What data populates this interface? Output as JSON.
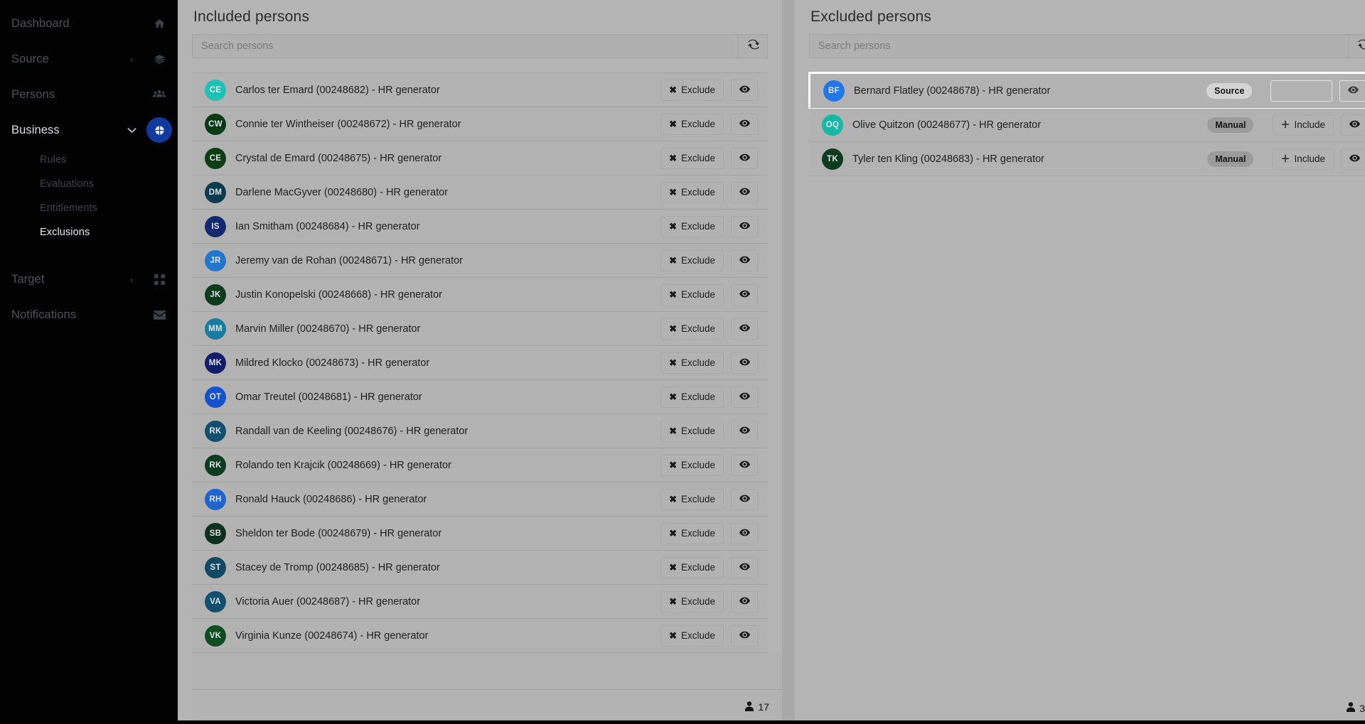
{
  "sidebar": {
    "items": [
      {
        "label": "Dashboard",
        "icon": "home-icon",
        "state": "dim",
        "caret": ""
      },
      {
        "label": "Source",
        "icon": "layers-icon",
        "state": "dim",
        "caret": "‹"
      },
      {
        "label": "Persons",
        "icon": "people-icon",
        "state": "dim",
        "caret": ""
      },
      {
        "label": "Business",
        "icon": "pie-chart-icon",
        "state": "active",
        "caret": "⌄"
      }
    ],
    "submenu": [
      {
        "label": "Rules",
        "active": false
      },
      {
        "label": "Evaluations",
        "active": false
      },
      {
        "label": "Entitlements",
        "active": false
      },
      {
        "label": "Exclusions",
        "active": true
      }
    ],
    "items_bottom": [
      {
        "label": "Target",
        "icon": "grid-icon",
        "state": "dim",
        "caret": "‹"
      },
      {
        "label": "Notifications",
        "icon": "envelope-icon",
        "state": "dim",
        "caret": ""
      }
    ],
    "accent_color": "#11399e"
  },
  "included": {
    "title": "Included persons",
    "search_placeholder": "Search persons",
    "search_value": "",
    "refresh_icon": "refresh-icon",
    "count": "17",
    "count_icon": "person-icon",
    "action_label": "Exclude",
    "action_glyph": "✖",
    "view_icon": "eye-icon",
    "persons": [
      {
        "initials": "CE",
        "color": "#1fc1b6",
        "label": "Carlos ter Emard (00248682) - HR generator"
      },
      {
        "initials": "CW",
        "color": "#073b15",
        "label": "Connie ter Wintheiser (00248672) - HR generator"
      },
      {
        "initials": "CE",
        "color": "#0c3d13",
        "label": "Crystal de Emard (00248675) - HR generator"
      },
      {
        "initials": "DM",
        "color": "#0c3a4f",
        "label": "Darlene MacGyver (00248680) - HR generator"
      },
      {
        "initials": "IS",
        "color": "#132a6e",
        "label": "Ian Smitham (00248684) - HR generator"
      },
      {
        "initials": "JR",
        "color": "#2277cd",
        "label": "Jeremy van de Rohan (00248671) - HR generator"
      },
      {
        "initials": "JK",
        "color": "#0d3b1e",
        "label": "Justin Konopelski (00248668) - HR generator"
      },
      {
        "initials": "MM",
        "color": "#187ca2",
        "label": "Marvin Miller (00248670) - HR generator"
      },
      {
        "initials": "MK",
        "color": "#131e6b",
        "label": "Mildred Klocko (00248673) - HR generator"
      },
      {
        "initials": "OT",
        "color": "#1451cf",
        "label": "Omar Treutel (00248681) - HR generator"
      },
      {
        "initials": "RK",
        "color": "#12506e",
        "label": "Randall van de Keeling (00248676) - HR generator"
      },
      {
        "initials": "RK",
        "color": "#0b3b20",
        "label": "Rolando ten Krajcik (00248669) - HR generator"
      },
      {
        "initials": "RH",
        "color": "#1f63cc",
        "label": "Ronald Hauck (00248686) - HR generator"
      },
      {
        "initials": "SB",
        "color": "#0c3022",
        "label": "Sheldon ter Bode (00248679) - HR generator"
      },
      {
        "initials": "ST",
        "color": "#114a62",
        "label": "Stacey de Tromp (00248685) - HR generator"
      },
      {
        "initials": "VA",
        "color": "#14506d",
        "label": "Victoria Auer (00248687) - HR generator"
      },
      {
        "initials": "VK",
        "color": "#0d4d21",
        "label": "Virginia Kunze (00248674) - HR generator"
      }
    ]
  },
  "excluded": {
    "title": "Excluded persons",
    "search_placeholder": "Search persons",
    "search_value": "",
    "refresh_icon": "refresh-icon",
    "count": "3",
    "count_icon": "person-icon",
    "action_label": "Include",
    "action_glyph": "＋",
    "view_icon": "eye-icon",
    "persons": [
      {
        "initials": "BF",
        "color": "#2277e8",
        "label": "Bernard Flatley (00248678) - HR generator",
        "badge": "Source",
        "highlight": true
      },
      {
        "initials": "OQ",
        "color": "#14b8a6",
        "label": "Olive Quitzon (00248677) - HR generator",
        "badge": "Manual",
        "highlight": false
      },
      {
        "initials": "TK",
        "color": "#0d3b1e",
        "label": "Tyler ten Kling (00248683) - HR generator",
        "badge": "Manual",
        "highlight": false
      }
    ]
  }
}
